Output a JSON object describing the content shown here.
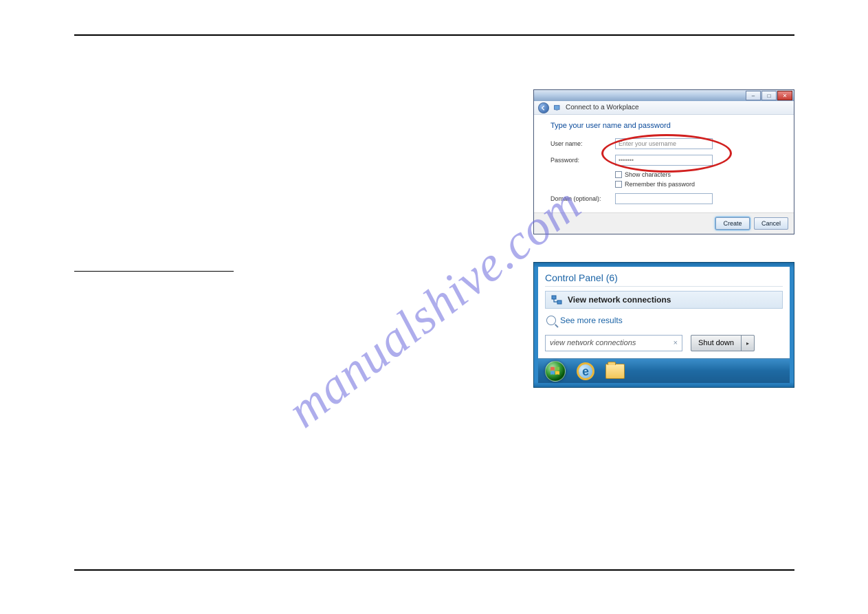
{
  "watermark": "manualshive.com",
  "left": {
    "underline_heading": ""
  },
  "dialog1": {
    "titlebar": {
      "min": "–",
      "max": "□",
      "close": "✕"
    },
    "wizard_label": "Connect to a Workplace",
    "heading": "Type your user name and password",
    "rows": {
      "username_label": "User name:",
      "username_value": "Enter your username",
      "password_label": "Password:",
      "password_value": "•••••••",
      "show_chars": "Show characters",
      "remember": "Remember this password",
      "domain_label": "Domain (optional):",
      "domain_value": ""
    },
    "buttons": {
      "create": "Create",
      "cancel": "Cancel"
    }
  },
  "panel2": {
    "cp_title": "Control Panel (6)",
    "item_label": "View network connections",
    "see_more": "See more results",
    "search_value": "view network connections",
    "clear": "×",
    "shutdown": "Shut down",
    "split": "▸"
  }
}
